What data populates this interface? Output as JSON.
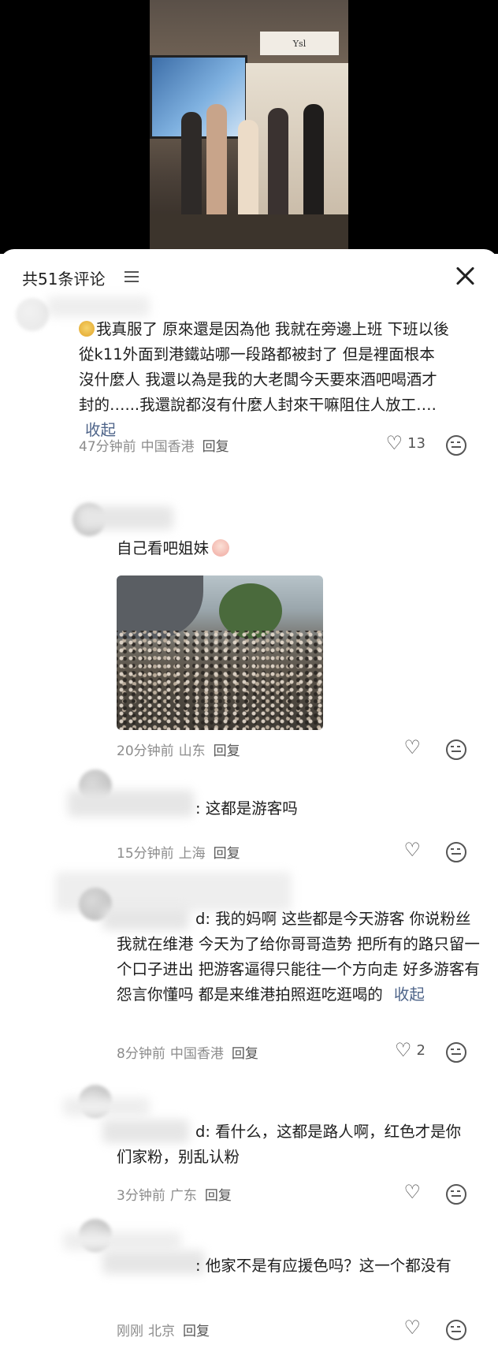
{
  "video": {
    "store_sign": "Ysl"
  },
  "header": {
    "title": "共51条评论"
  },
  "comments": [
    {
      "prefix": "",
      "text": "我真服了 原來還是因為他 我就在旁邊上班 下班以後 從k11外面到港鐵站哪一段路都被封了 但是裡面根本沒什麼人 我還以為是我的大老闆今天要來酒吧喝酒才封的…...我還說都沒有什麼人封來干嘛阻住人放工…. ",
      "collapse": "收起",
      "time": "47分钟前",
      "location": "中国香港",
      "reply": "回复",
      "likes": "13"
    },
    {
      "prefix": "",
      "text": "自己看吧姐妹",
      "time": "20分钟前",
      "location": "山东",
      "reply": "回复",
      "likes": ""
    },
    {
      "prefix": ":",
      "text": "这都是游客吗",
      "time": "15分钟前",
      "location": "上海",
      "reply": "回复",
      "likes": ""
    },
    {
      "prefix": "d:",
      "text": "我的妈啊 这些都是今天游客 你说粉丝 我就在维港 今天为了给你哥哥造势 把所有的路只留一个口子进出 把游客逼得只能往一个方向走 好多游客有怨言你懂吗 都是来维港拍照逛吃逛喝的 ",
      "collapse": "收起",
      "time": "8分钟前",
      "location": "中国香港",
      "reply": "回复",
      "likes": "2"
    },
    {
      "prefix": "d:",
      "text": "看什么，这都是路人啊，红色才是你们家粉，别乱认粉",
      "time": "3分钟前",
      "location": "广东",
      "reply": "回复",
      "likes": ""
    },
    {
      "prefix": ":",
      "text": "他家不是有应援色吗？这一个都没有",
      "time": "刚刚",
      "location": "北京",
      "reply": "回复",
      "likes": ""
    }
  ]
}
